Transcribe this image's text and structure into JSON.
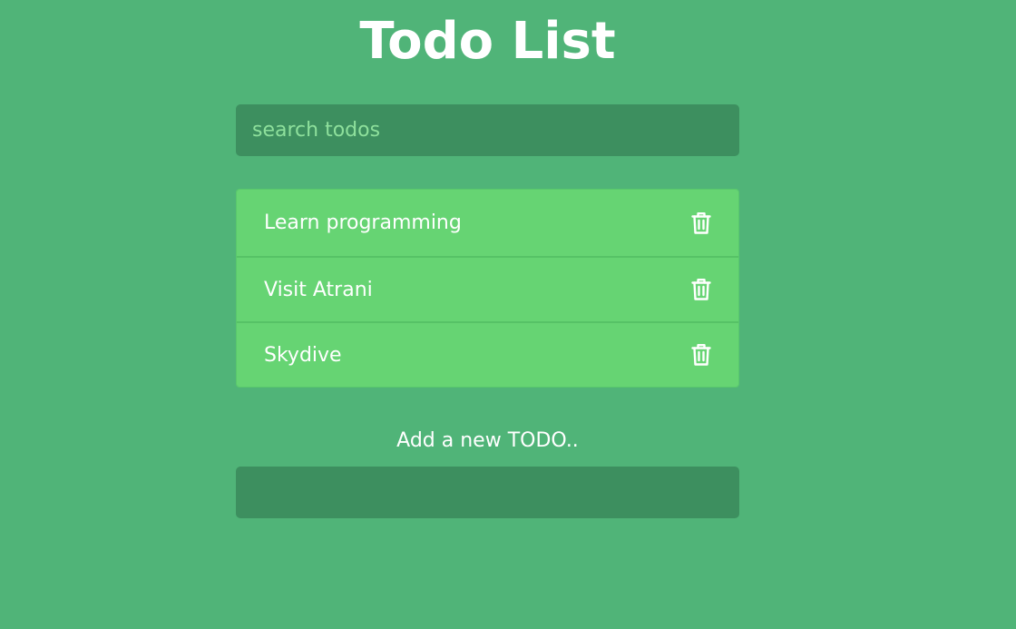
{
  "header": {
    "title": "Todo List"
  },
  "search": {
    "placeholder": "search todos",
    "value": ""
  },
  "todos": [
    {
      "text": "Learn programming",
      "action_icon": "trash-icon"
    },
    {
      "text": "Visit Atrani",
      "action_icon": "trash-icon"
    },
    {
      "text": "Skydive",
      "action_icon": "trash-icon"
    }
  ],
  "add_form": {
    "label": "Add a new TODO..",
    "value": ""
  },
  "colors": {
    "background": "#50b478",
    "input_background": "#3d8f5f",
    "todo_item_background": "#66d473",
    "placeholder_text": "#8ee09c",
    "text": "#ffffff"
  }
}
